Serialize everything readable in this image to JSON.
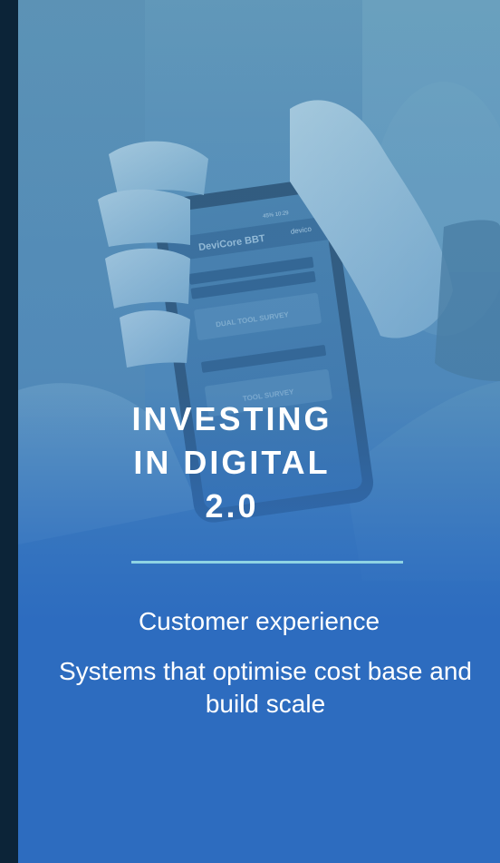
{
  "headline": {
    "line1": "INVESTING",
    "line2": "IN DIGITAL",
    "line3": "2.0"
  },
  "points": [
    "Customer experience",
    "Systems that optimise cost base and build scale"
  ],
  "photo": {
    "app_name": "DeviCore BBT",
    "button1": "DUAL TOOL SURVEY",
    "button2": "TOOL SURVEY",
    "status": "45% 10:29",
    "brand": "devico"
  },
  "colors": {
    "panel_blue": "#2d6cbf",
    "divider": "#8fd3e3",
    "dark_strip": "#0c2438"
  }
}
